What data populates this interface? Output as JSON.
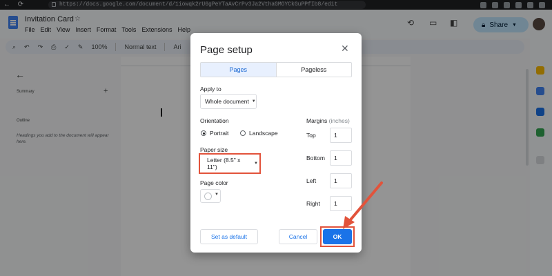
{
  "browser": {
    "url": "https://docs.google.com/document/d/1iowqk2rU6gPeYTaAvCrPv3Ja2VthaGMOYCkGuPPfIb8/edit"
  },
  "docs": {
    "title": "Invitation Card",
    "menu": [
      "File",
      "Edit",
      "View",
      "Insert",
      "Format",
      "Tools",
      "Extensions",
      "Help"
    ],
    "share_label": "Share",
    "toolbar": {
      "zoom": "100%",
      "style": "Normal text",
      "font": "Ari"
    },
    "outline": {
      "summary_label": "Summary",
      "outline_label": "Outline",
      "hint": "Headings you add to the document will appear here."
    }
  },
  "dialog": {
    "title": "Page setup",
    "tabs": [
      "Pages",
      "Pageless"
    ],
    "apply_to_label": "Apply to",
    "apply_to_value": "Whole document",
    "orientation_label": "Orientation",
    "orientation_options": [
      "Portrait",
      "Landscape"
    ],
    "orientation_selected": "Portrait",
    "paper_size_label": "Paper size",
    "paper_size_value": "Letter (8.5\" x 11\")",
    "page_color_label": "Page color",
    "margins_label": "Margins",
    "margins_unit": "(inches)",
    "margins": [
      {
        "label": "Top",
        "value": "1"
      },
      {
        "label": "Bottom",
        "value": "1"
      },
      {
        "label": "Left",
        "value": "1"
      },
      {
        "label": "Right",
        "value": "1"
      }
    ],
    "set_default_label": "Set as default",
    "cancel_label": "Cancel",
    "ok_label": "OK"
  },
  "colors": {
    "accent": "#1a73e8",
    "annotation": "#e2533b"
  }
}
